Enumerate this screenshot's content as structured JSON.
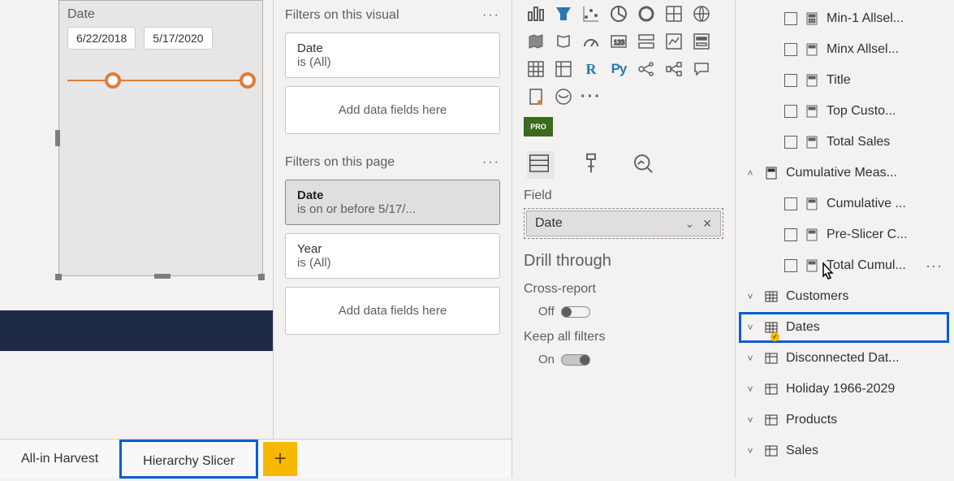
{
  "visual": {
    "title": "Date",
    "start": "6/22/2018",
    "end": "5/17/2020"
  },
  "tabs": {
    "t1": "All-in Harvest",
    "t2": "Hierarchy Slicer",
    "add": "+"
  },
  "filters": {
    "visual_header": "Filters on this visual",
    "page_header": "Filters on this page",
    "card_date_name": "Date",
    "card_date_sub": "is (All)",
    "card_page_date_name": "Date",
    "card_page_date_sub": "is on or before 5/17/...",
    "card_year_name": "Year",
    "card_year_sub": "is (All)",
    "drop_text": "Add data fields here"
  },
  "viz": {
    "pro": "PRO",
    "field_label": "Field",
    "chip": "Date",
    "drill_heading": "Drill through",
    "cross": "Cross-report",
    "keep": "Keep all filters",
    "off": "Off",
    "on": "On",
    "dots": "···",
    "r": "R",
    "py": "Py"
  },
  "fields": {
    "m1": "Min-1 Allsel...",
    "m2": "Minx Allsel...",
    "m3": "Title",
    "m4": "Top Custo...",
    "m5": "Total Sales",
    "group": "Cumulative Meas...",
    "g1": "Cumulative ...",
    "g2": "Pre-Slicer C...",
    "g3": "Total Cumul...",
    "t_customers": "Customers",
    "t_dates": "Dates",
    "t_disc": "Disconnected Dat...",
    "t_holiday": "Holiday 1966-2029",
    "t_products": "Products",
    "t_sales": "Sales"
  }
}
